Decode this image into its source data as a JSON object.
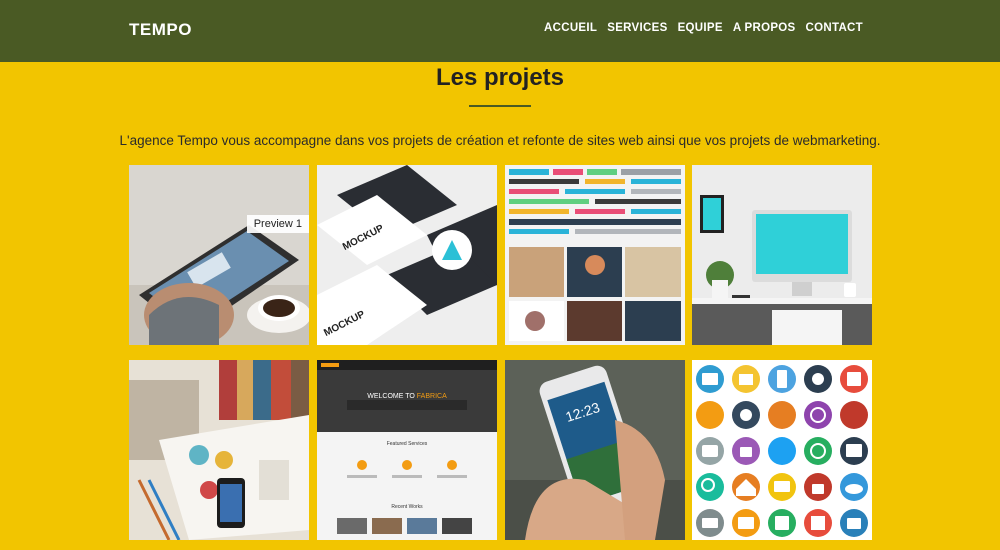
{
  "brand": "TEMPO",
  "nav": [
    "ACCUEIL",
    "SERVICES",
    "EQUIPE",
    "A PROPOS",
    "CONTACT"
  ],
  "section": {
    "title": "Les projets",
    "intro": "L'agence Tempo vous accompagne dans vos projets de création et refonte de sites web ainsi que vos projets de webmarketing."
  },
  "projects": [
    {
      "badge": "Preview 1"
    },
    {
      "mockup_text": "MOCKUP"
    },
    {},
    {},
    {},
    {
      "welcome": "WELCOME TO",
      "brand": "FABRICA",
      "section": "Featured Services",
      "section2": "Recent Works"
    },
    {
      "time": "12:23"
    },
    {}
  ],
  "colors": {
    "navbar": "#4a5a24",
    "background": "#f2c500"
  }
}
